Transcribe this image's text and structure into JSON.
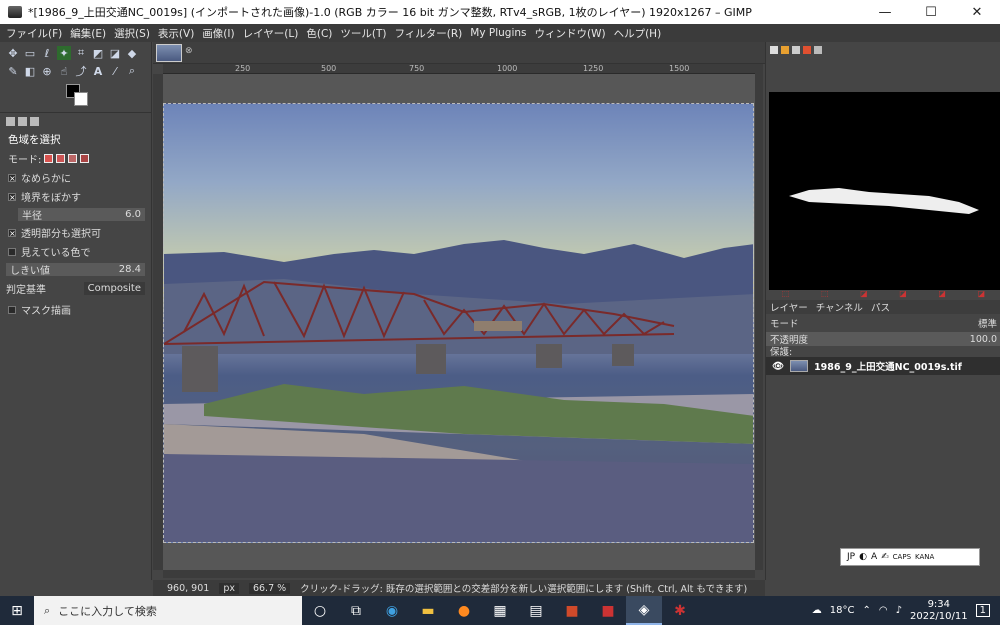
{
  "window": {
    "title": "*[1986_9_上田交通NC_0019s] (インポートされた画像)-1.0 (RGB カラー 16 bit ガンマ整数, RTv4_sRGB, 1枚のレイヤー) 1920x1267 – GIMP",
    "minimize": "—",
    "maximize": "☐",
    "close": "✕"
  },
  "menu": [
    "ファイル(F)",
    "編集(E)",
    "選択(S)",
    "表示(V)",
    "画像(I)",
    "レイヤー(L)",
    "色(C)",
    "ツール(T)",
    "フィルター(R)",
    "My Plugins",
    "ウィンドウ(W)",
    "ヘルプ(H)"
  ],
  "tool_options": {
    "title": "色域を選択",
    "mode_label": "モード:",
    "antialias": "なめらかに",
    "feather": "境界をぼかす",
    "radius_label": "半径",
    "radius_value": "6.0",
    "select_transparent": "透明部分も選択可",
    "sample_merged": "見えている色で",
    "threshold_label": "しきい値",
    "threshold_value": "28.4",
    "criterion_label": "判定基準",
    "criterion_value": "Composite",
    "draw_mask": "マスク描画"
  },
  "ruler": [
    "250",
    "500",
    "750",
    "1000",
    "1250",
    "1500"
  ],
  "status": {
    "coords": "960, 901",
    "unit": "px",
    "zoom": "66.7 %",
    "message": "クリック-ドラッグ: 既存の選択範囲との交差部分を新しい選択範囲にします (Shift, Ctrl, Alt もできます)"
  },
  "layers": {
    "tabs": [
      "レイヤー",
      "チャンネル",
      "パス"
    ],
    "mode_label": "モード",
    "mode_value": "標準",
    "opacity_label": "不透明度",
    "opacity_value": "100.0",
    "lock_label": "保護:",
    "layer_name": "1986_9_上田交通NC_0019s.tif"
  },
  "ime": {
    "lang": "JP",
    "caps": "CAPS",
    "kana": "KANA"
  },
  "taskbar": {
    "search_placeholder": "ここに入力して検索",
    "weather": "18°C",
    "time": "9:34",
    "date": "2022/10/11",
    "notifications": "1"
  }
}
